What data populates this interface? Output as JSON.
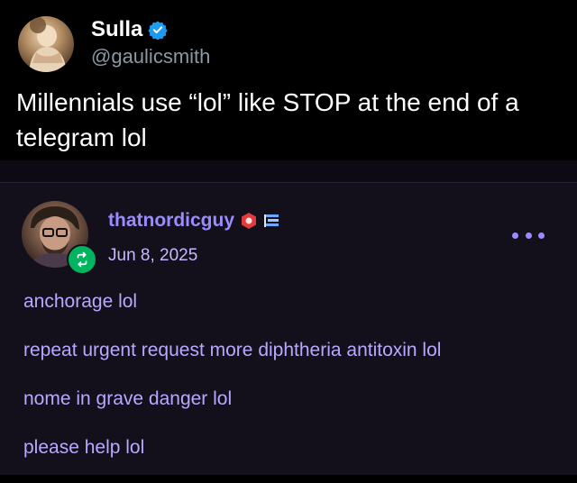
{
  "tweet": {
    "name": "Sulla",
    "handle": "@gaulicsmith",
    "text": "Millennials use “lol” like STOP at the end of a telegram lol",
    "verified_color": "#1d9bf0"
  },
  "post": {
    "author": "thatnordicguy",
    "date": "Jun 8, 2025",
    "lines": [
      "anchorage lol",
      "repeat urgent request more diphtheria antitoxin lol",
      "nome in grave danger lol",
      "please help lol"
    ],
    "accent_color": "#9a8cff",
    "reblog_color": "#00b35f"
  },
  "icons": {
    "verified": "verified-badge-icon",
    "reblog": "reblog-icon",
    "more": "more-options-icon",
    "badge_red": "red-hex-badge-icon",
    "badge_flag": "flag-badge-icon"
  }
}
